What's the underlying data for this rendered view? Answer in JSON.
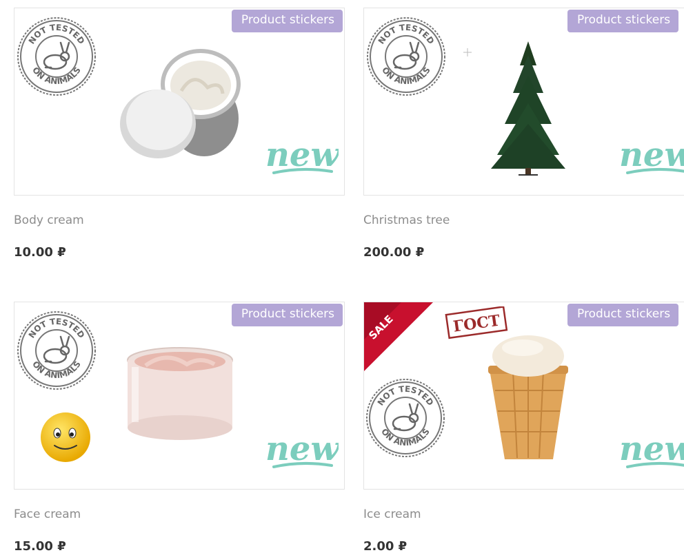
{
  "products": [
    {
      "name": "Body cream",
      "price": "10.00 ₽",
      "sticker_label": "Product stickers",
      "stamp_top_text": "NOT TESTED",
      "stamp_bottom_text": "ON ANIMALS",
      "new_label": "new"
    },
    {
      "name": "Christmas tree",
      "price": "200.00 ₽",
      "sticker_label": "Product stickers",
      "stamp_top_text": "NOT TESTED",
      "stamp_bottom_text": "ON ANIMALS",
      "new_label": "new"
    },
    {
      "name": "Face cream",
      "price": "15.00 ₽",
      "sticker_label": "Product stickers",
      "stamp_top_text": "NOT TESTED",
      "stamp_bottom_text": "ON ANIMALS",
      "new_label": "new"
    },
    {
      "name": "Ice cream",
      "price": "2.00 ₽",
      "sticker_label": "Product stickers",
      "stamp_top_text": "NOT TESTED",
      "stamp_bottom_text": "ON ANIMALS",
      "new_label": "new",
      "sale_label": "SALE",
      "gost_label": "ГОСТ"
    }
  ],
  "colors": {
    "sticker_bg": "#b3a6d6",
    "new_teal": "#7ccdbd",
    "sale_red": "#c8102e",
    "gost_red": "#9b2a2a"
  },
  "icons": {
    "stamp": "not-tested-on-animals-stamp-icon",
    "new": "new-sticker-icon",
    "sale": "sale-ribbon-icon",
    "gost": "gost-stamp-icon",
    "smiley": "smiley-sticker-icon"
  }
}
